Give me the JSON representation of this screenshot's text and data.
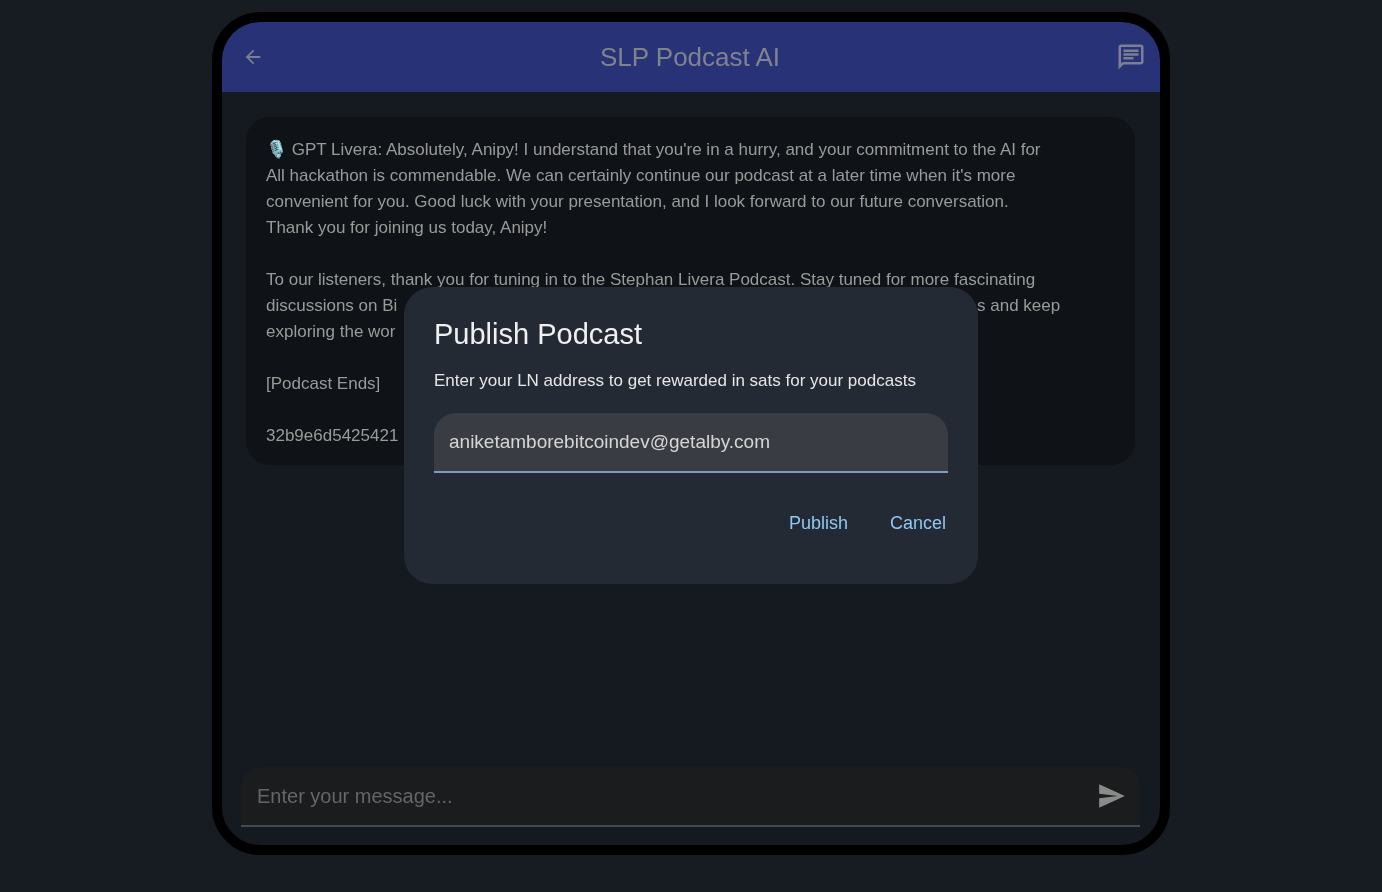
{
  "app_bar": {
    "title": "SLP Podcast AI"
  },
  "message": {
    "paragraphs": [
      [
        [
          {
            "text": "🎙️ GPT Livera: Absolutely, Anipy! I understand that you're in a hurry, and your commitment to the AI for"
          }
        ],
        [
          {
            "text": "All hackathon is commendable. We can certainly continue our podcast at a later time when it's more"
          }
        ],
        [
          {
            "text": "convenient for you. Good luck with your presentation, and I look forward to our future conversation."
          }
        ],
        [
          {
            "text": "Thank you for joining us today, Anipy!"
          }
        ]
      ],
      [
        [
          {
            "text": "To our listeners, thank you for tuning in to the Stephan Livera Podcast. Stay tuned for more fascinating"
          }
        ],
        [
          {
            "text": "discussions on Bi"
          },
          {
            "text": "s and keep"
          }
        ],
        [
          {
            "text": "exploring the wor"
          }
        ]
      ],
      [
        [
          {
            "text": "[Podcast Ends]"
          }
        ]
      ],
      [
        [
          {
            "text": "32b9e6d5425421"
          }
        ]
      ]
    ]
  },
  "dialog": {
    "title": "Publish Podcast",
    "description": "Enter your LN address to get rewarded in sats for your podcasts",
    "field": {
      "value": "aniketamborebitcoindev@getalby.com"
    },
    "buttons": [
      "Publish",
      "Cancel"
    ]
  },
  "composer": {
    "placeholder": "Enter your message..."
  }
}
